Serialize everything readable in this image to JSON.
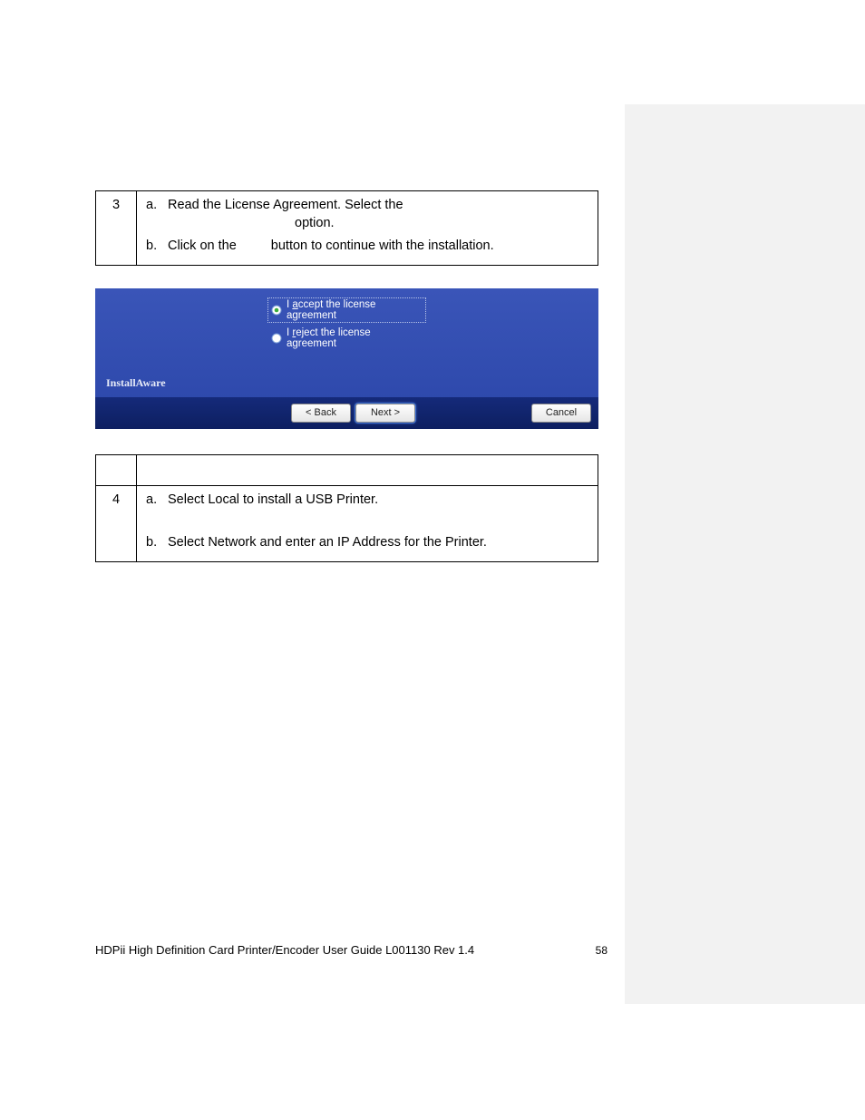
{
  "step3": {
    "number": "3",
    "a_letter": "a.",
    "a_text1": "Read the License Agreement. Select the",
    "a_text2": "option.",
    "b_letter": "b.",
    "b_text1": "Click on the",
    "b_text2": "button to continue with the installation."
  },
  "installer": {
    "accept_pre": "I ",
    "accept_u": "a",
    "accept_post": "ccept the license agreement",
    "reject_pre": "I ",
    "reject_u": "r",
    "reject_post": "eject the license agreement",
    "brand": "InstallAware",
    "back": "< Back",
    "next": "Next >",
    "cancel": "Cancel"
  },
  "step4": {
    "number": "4",
    "a_letter": "a.",
    "a_text": "Select Local to install a USB Printer.",
    "b_letter": "b.",
    "b_text": "Select Network and enter an IP Address for the Printer."
  },
  "footer": {
    "title": "HDPii High Definition Card Printer/Encoder User Guide    L001130 Rev 1.4",
    "page": "58"
  }
}
